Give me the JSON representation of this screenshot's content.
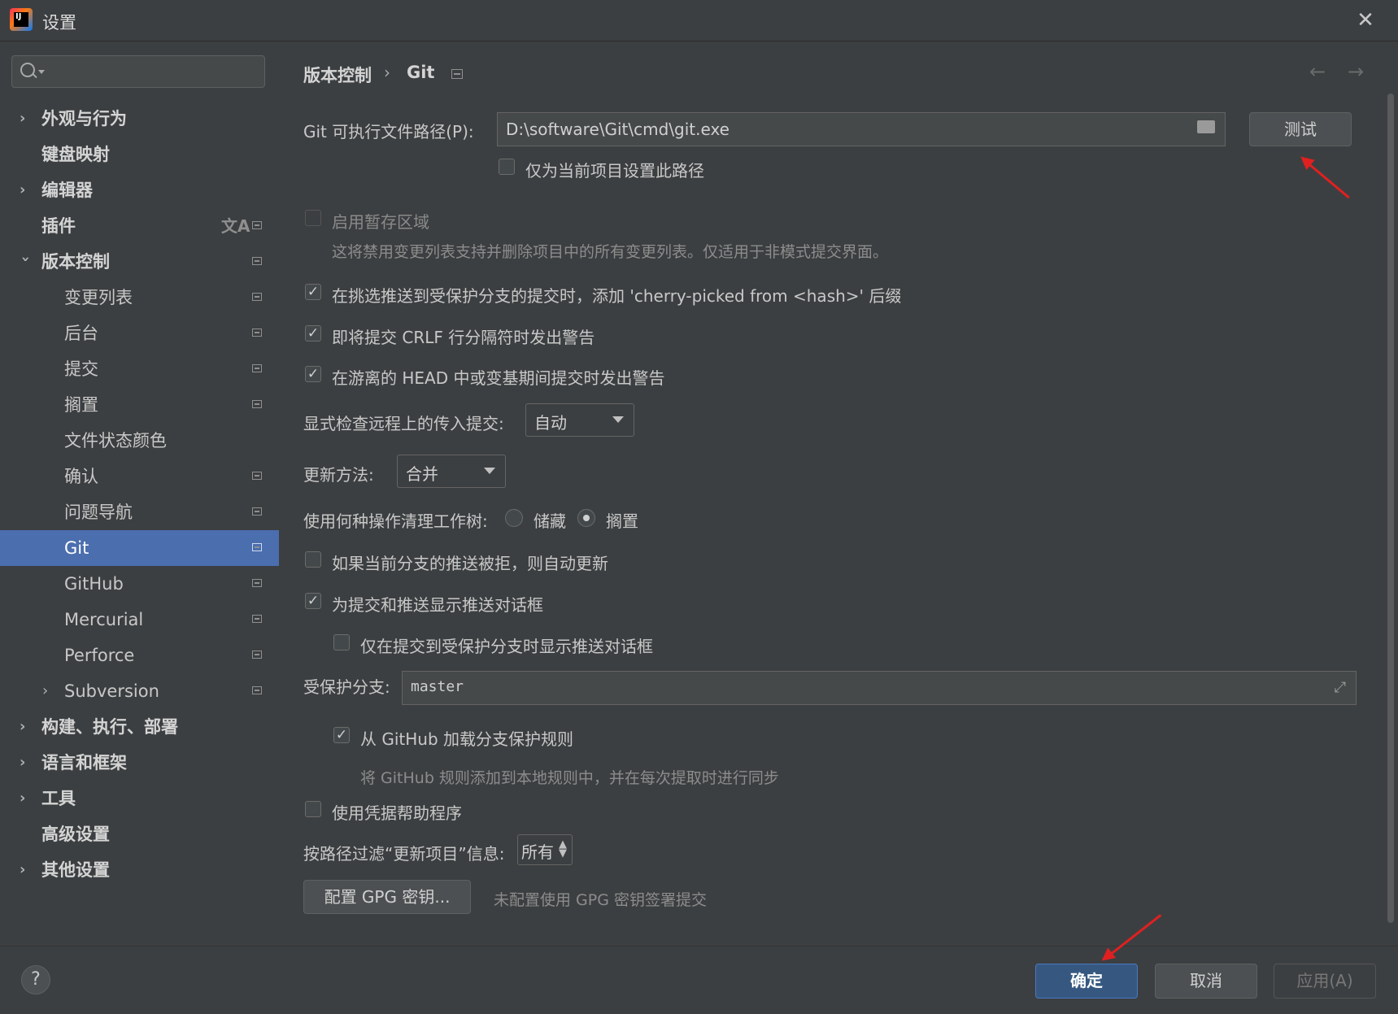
{
  "window": {
    "title": "设置",
    "logo_text": "IJ"
  },
  "search": {
    "placeholder": ""
  },
  "sidebar": {
    "items": [
      {
        "label": "外观与行为"
      },
      {
        "label": "键盘映射"
      },
      {
        "label": "编辑器"
      },
      {
        "label": "插件"
      },
      {
        "label": "版本控制"
      },
      {
        "label": "变更列表"
      },
      {
        "label": "后台"
      },
      {
        "label": "提交"
      },
      {
        "label": "搁置"
      },
      {
        "label": "文件状态颜色"
      },
      {
        "label": "确认"
      },
      {
        "label": "问题导航"
      },
      {
        "label": "Git"
      },
      {
        "label": "GitHub"
      },
      {
        "label": "Mercurial"
      },
      {
        "label": "Perforce"
      },
      {
        "label": "Subversion"
      },
      {
        "label": "构建、执行、部署"
      },
      {
        "label": "语言和框架"
      },
      {
        "label": "工具"
      },
      {
        "label": "高级设置"
      },
      {
        "label": "其他设置"
      }
    ],
    "selected": "Git"
  },
  "breadcrumb": {
    "parent": "版本控制",
    "separator": "›",
    "current": "Git"
  },
  "git": {
    "path_label": "Git 可执行文件路径(P):",
    "path_value": "D:\\software\\Git\\cmd\\git.exe",
    "test_button": "测试",
    "project_only_label": "仅为当前项目设置此路径",
    "project_only_checked": false,
    "staging_label": "启用暂存区域",
    "staging_checked": false,
    "staging_hint": "这将禁用变更列表支持并删除项目中的所有变更列表。仅适用于非模式提交界面。",
    "cherry_label": "在挑选推送到受保护分支的提交时，添加 'cherry-picked from <hash>' 后缀",
    "cherry_checked": true,
    "crlf_label": "即将提交 CRLF 行分隔符时发出警告",
    "crlf_checked": true,
    "detached_label": "在游离的 HEAD 中或变基期间提交时发出警告",
    "detached_checked": true,
    "incoming_label": "显式检查远程上的传入提交:",
    "incoming_value": "自动",
    "update_label": "更新方法:",
    "update_value": "合并",
    "clean_label": "使用何种操作清理工作树:",
    "clean_options": [
      "储藏",
      "搁置"
    ],
    "clean_selected": "搁置",
    "auto_update_label": "如果当前分支的推送被拒，则自动更新",
    "auto_update_checked": false,
    "push_dialog_label": "为提交和推送显示推送对话框",
    "push_dialog_checked": true,
    "push_dialog_protected_label": "仅在提交到受保护分支时显示推送对话框",
    "push_dialog_protected_checked": false,
    "protected_label": "受保护分支:",
    "protected_value": "master",
    "github_rules_label": "从 GitHub 加载分支保护规则",
    "github_rules_checked": true,
    "github_rules_hint": "将 GitHub 规则添加到本地规则中，并在每次提取时进行同步",
    "credential_label": "使用凭据帮助程序",
    "credential_checked": false,
    "filter_label": "按路径过滤“更新项目”信息:",
    "filter_value": "所有",
    "gpg_button": "配置 GPG 密钥...",
    "gpg_hint": "未配置使用 GPG 密钥签署提交"
  },
  "footer": {
    "help": "?",
    "ok": "确定",
    "cancel": "取消",
    "apply": "应用(A)"
  },
  "colors": {
    "accent": "#4b6eaf",
    "background": "#3c3f41",
    "annotation": "#e02020"
  }
}
